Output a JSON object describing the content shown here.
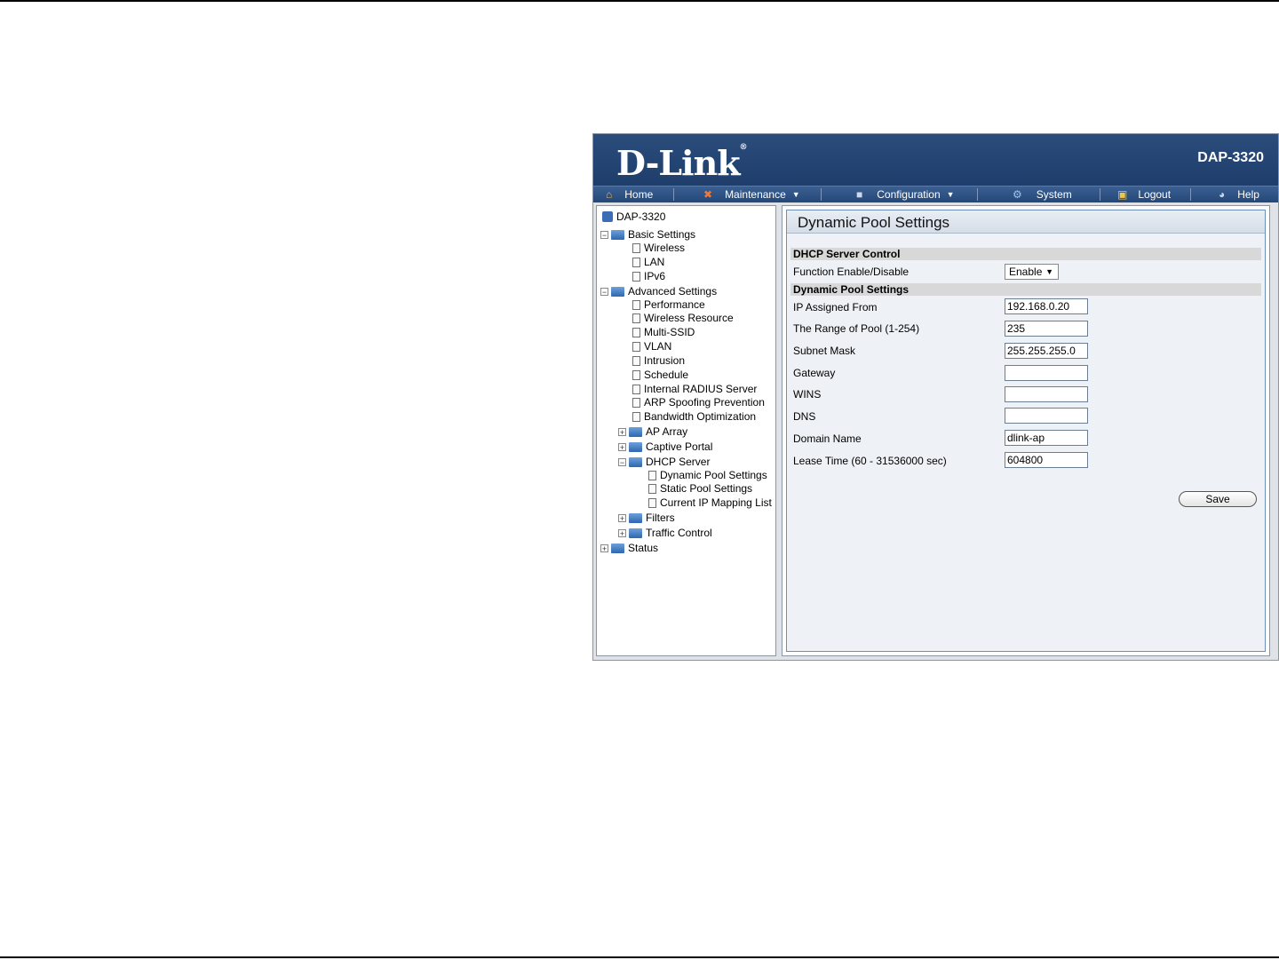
{
  "header": {
    "logo_text": "D-Link",
    "registered_mark": "®",
    "model": "DAP-3320"
  },
  "menu": [
    {
      "label": "Home",
      "icon": "home-icon"
    },
    {
      "label": "Maintenance",
      "icon": "tools-icon",
      "has_dropdown": true
    },
    {
      "label": "Configuration",
      "icon": "save-disk-icon",
      "has_dropdown": true
    },
    {
      "label": "System",
      "icon": "system-icon"
    },
    {
      "label": "Logout",
      "icon": "logout-icon"
    },
    {
      "label": "Help",
      "icon": "help-icon"
    }
  ],
  "tree": {
    "root": "DAP-3320",
    "basic_settings": "Basic Settings",
    "basic_items": [
      "Wireless",
      "LAN",
      "IPv6"
    ],
    "advanced_settings": "Advanced Settings",
    "advanced_items": [
      "Performance",
      "Wireless Resource",
      "Multi-SSID",
      "VLAN",
      "Intrusion",
      "Schedule",
      "Internal RADIUS Server",
      "ARP Spoofing Prevention",
      "Bandwidth Optimization"
    ],
    "ap_array": "AP Array",
    "captive_portal": "Captive Portal",
    "dhcp_server": "DHCP Server",
    "dhcp_items": [
      "Dynamic Pool Settings",
      "Static Pool Settings",
      "Current IP Mapping List"
    ],
    "filters": "Filters",
    "traffic_control": "Traffic Control",
    "status": "Status"
  },
  "content": {
    "title": "Dynamic Pool Settings",
    "section_dhcp_control": "DHCP Server Control",
    "function_label": "Function Enable/Disable",
    "function_value": "Enable",
    "section_pool": "Dynamic Pool Settings",
    "fields": [
      {
        "label": "IP Assigned From",
        "value": "192.168.0.20"
      },
      {
        "label": "The Range of Pool (1-254)",
        "value": "235"
      },
      {
        "label": "Subnet Mask",
        "value": "255.255.255.0"
      },
      {
        "label": "Gateway",
        "value": ""
      },
      {
        "label": "WINS",
        "value": ""
      },
      {
        "label": "DNS",
        "value": ""
      },
      {
        "label": "Domain Name",
        "value": "dlink-ap"
      },
      {
        "label": "Lease Time (60 - 31536000 sec)",
        "value": "604800"
      }
    ],
    "save_label": "Save"
  }
}
